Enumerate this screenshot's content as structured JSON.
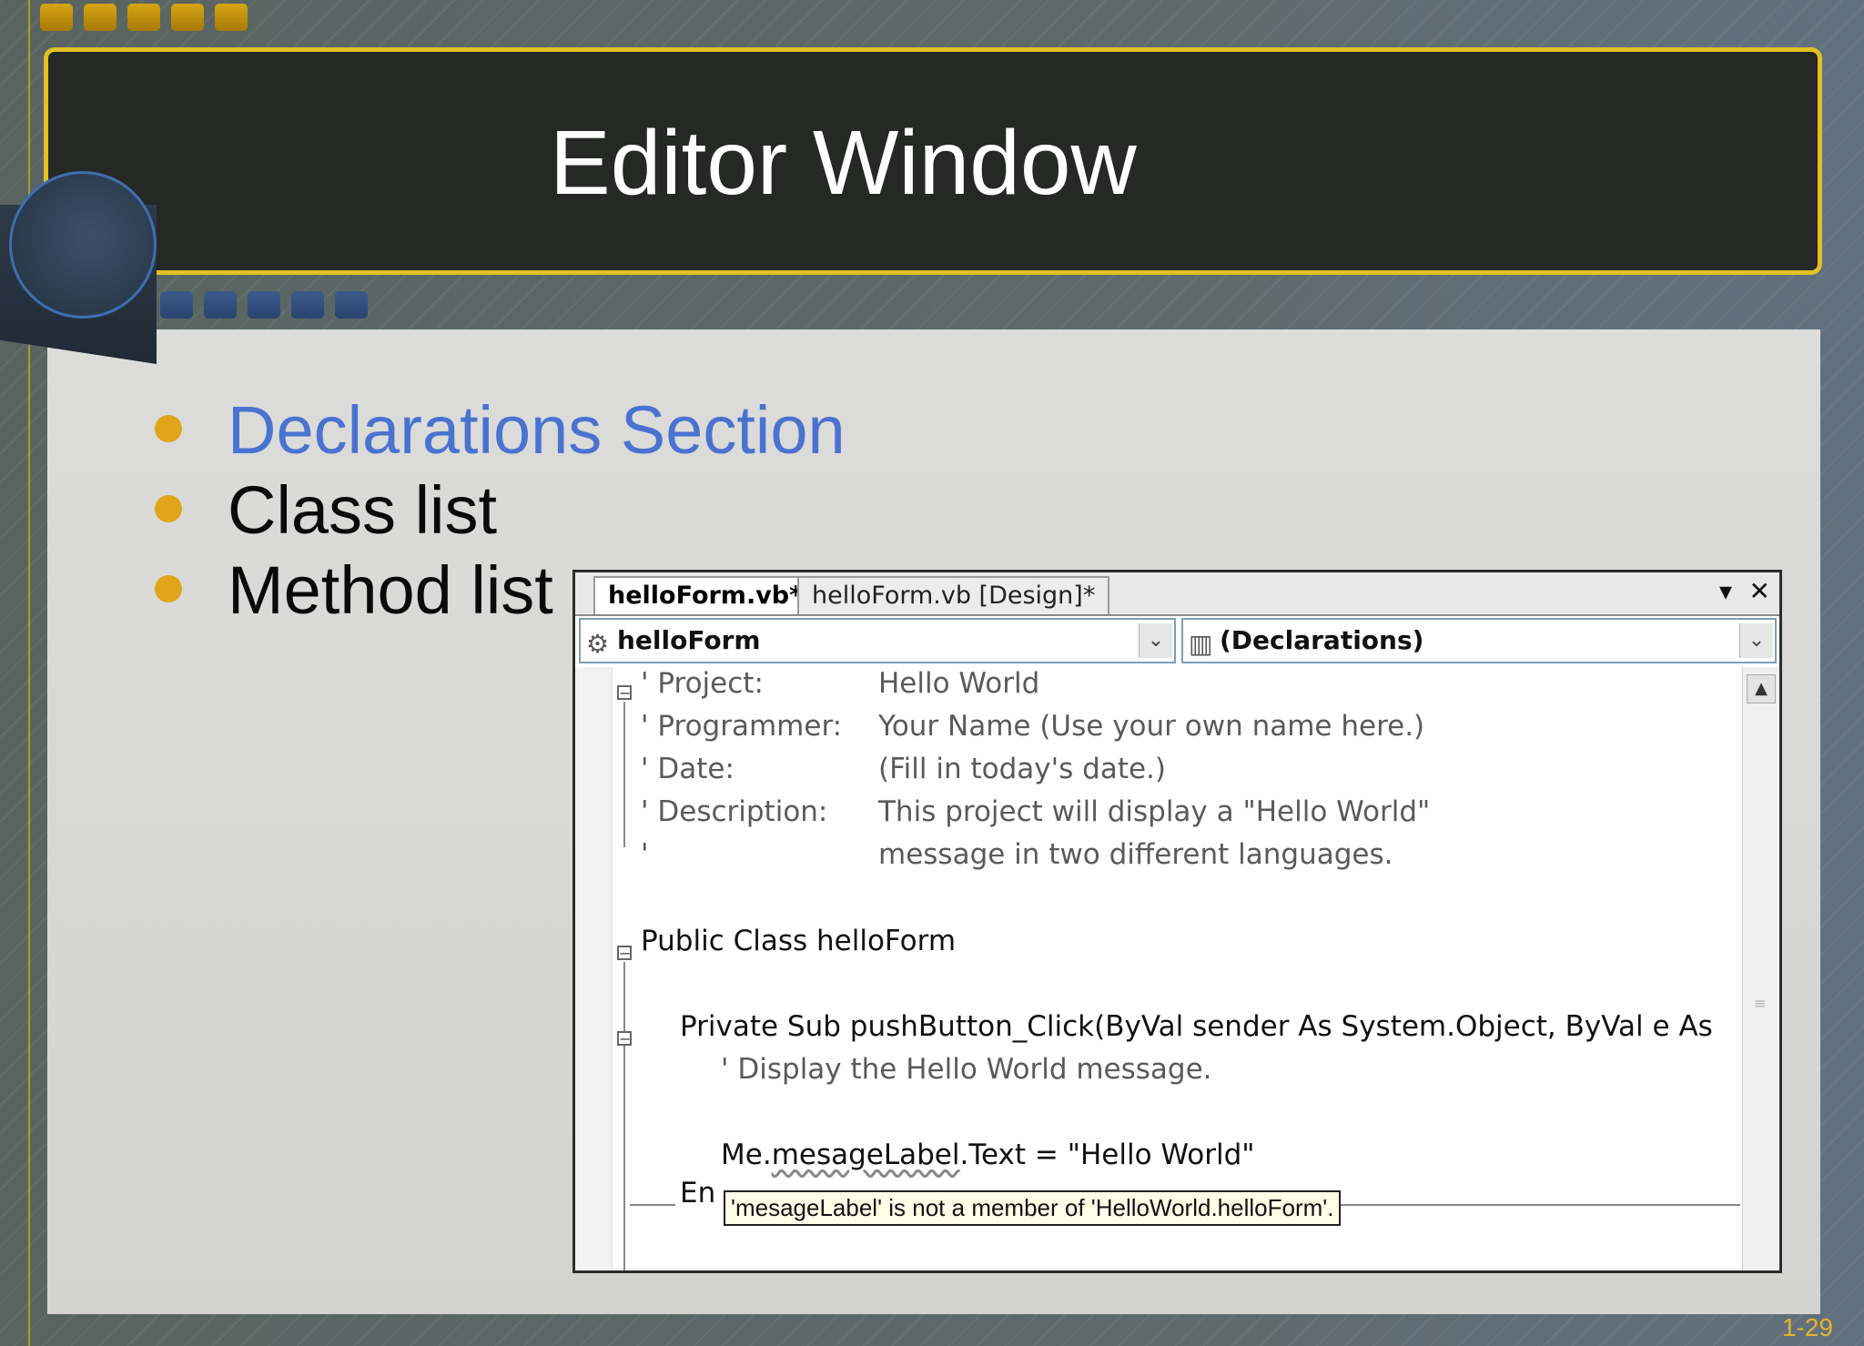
{
  "slide": {
    "title": "Editor Window",
    "page_number": "1-29"
  },
  "bullets": [
    {
      "text": "Declarations Section",
      "highlighted": true
    },
    {
      "text": "Class list",
      "highlighted": false
    },
    {
      "text": "Method list",
      "highlighted": false
    }
  ],
  "colors": {
    "highlight_bullet": "#4a72d0",
    "bullet_dot": "#e0a51a",
    "title_border": "#e2c124"
  },
  "editor": {
    "tabs": [
      {
        "label": "helloForm.vb*",
        "active": true
      },
      {
        "label": "helloForm.vb [Design]*",
        "active": false
      }
    ],
    "tab_controls": {
      "dropdown": "▾",
      "close": "✕"
    },
    "class_combo": {
      "value": "helloForm",
      "icon": "class-icon"
    },
    "method_combo": {
      "value": "(Declarations)",
      "icon": "declarations-icon"
    },
    "code": {
      "l1_key": "' Project:",
      "l1_val": "Hello World",
      "l2_key": "' Programmer:",
      "l2_val": "Your Name (Use your own name here.)",
      "l3_key": "' Date:",
      "l3_val": "(Fill in today's date.)",
      "l4_key": "' Description:",
      "l4_val": "This project will display a \"Hello World\"",
      "l5_key": "'",
      "l5_val": "message in two different languages.",
      "l6": "Public Class helloForm",
      "l7": "Private Sub pushButton_Click(ByVal sender As System.Object, ByVal e As",
      "l8": "' Display the Hello World message.",
      "l9_prefix": "Me.",
      "l9_squiggle": "mesageLabel",
      "l9_suffix": ".Text = \"Hello World\"",
      "l10": "En"
    },
    "tooltip": "'mesageLabel' is not a member of 'HelloWorld.helloForm'."
  }
}
